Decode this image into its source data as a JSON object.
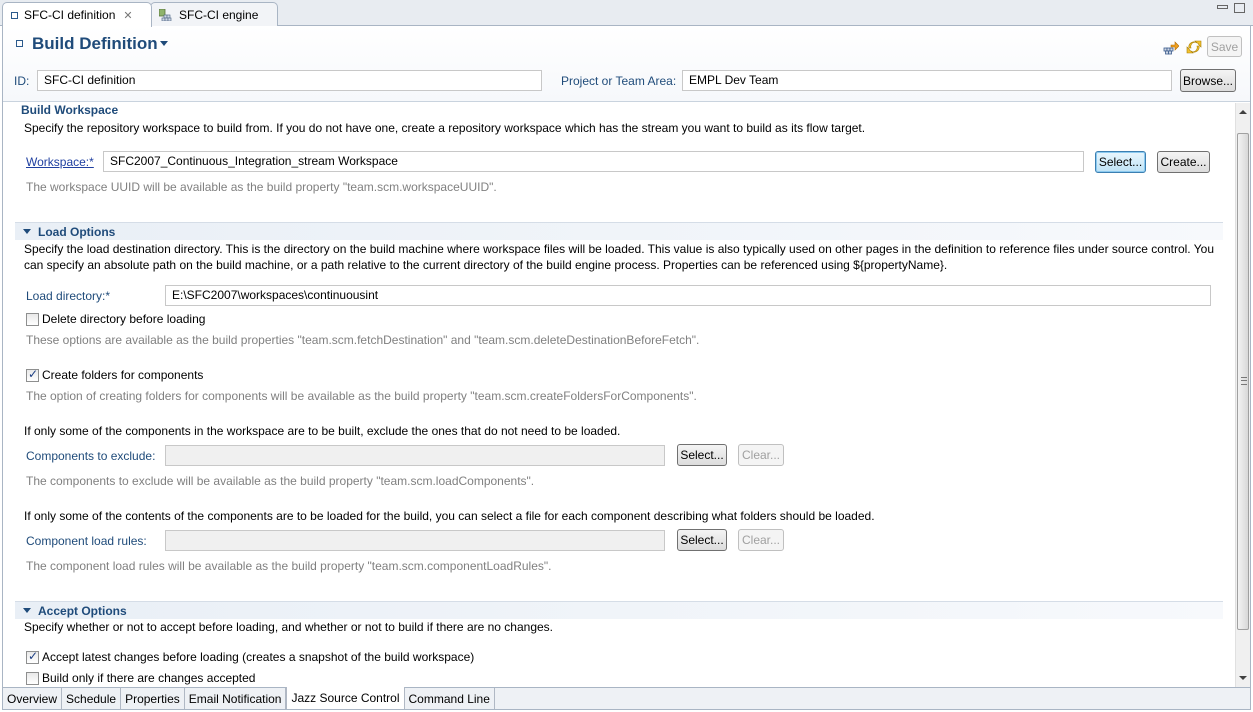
{
  "tabs": [
    {
      "label": "SFC-CI definition",
      "active": true,
      "closable": true,
      "icon": "editor-square-icon"
    },
    {
      "label": "SFC-CI engine",
      "active": false,
      "icon": "build-engine-icon"
    }
  ],
  "header": {
    "title": "Build Definition",
    "save_label": "Save",
    "id_label": "ID:",
    "id_value": "SFC-CI definition",
    "project_label": "Project or Team Area:",
    "project_value": "EMPL Dev Team",
    "browse_label": "Browse..."
  },
  "build_workspace": {
    "heading": "Build Workspace",
    "description": "Specify the repository workspace to build from. If you do not have one, create a repository workspace which has the stream you want to build as its flow target.",
    "workspace_label": "Workspace:*",
    "workspace_value": "SFC2007_Continuous_Integration_stream Workspace",
    "select_label": "Select...",
    "create_label": "Create...",
    "hint": "The workspace UUID will be available as the build property \"team.scm.workspaceUUID\"."
  },
  "load_options": {
    "heading": "Load Options",
    "description": "Specify the load destination directory. This is the directory on the build machine where workspace files will be loaded. This value is also typically used on other pages in the definition to reference files under source control. You can specify an absolute path on the build machine, or a path relative to the current directory of the build engine process. Properties can be referenced using ${propertyName}.",
    "load_dir_label": "Load directory:*",
    "load_dir_value": "E:\\SFC2007\\workspaces\\continuousint",
    "delete_dir_label": "Delete directory before loading",
    "delete_dir_checked": false,
    "delete_hint": "These options are available as the build properties \"team.scm.fetchDestination\" and \"team.scm.deleteDestinationBeforeFetch\".",
    "create_folders_label": "Create folders for components",
    "create_folders_checked": true,
    "create_folders_hint": "The option of creating folders for components will be available as the build property \"team.scm.createFoldersForComponents\".",
    "exclude_intro": "If only some of the components in the workspace are to be built, exclude the ones that do not need to be loaded.",
    "exclude_label": "Components to exclude:",
    "exclude_value": "",
    "exclude_select": "Select...",
    "exclude_clear": "Clear...",
    "exclude_hint": "The components to exclude will be available as the build property \"team.scm.loadComponents\".",
    "rules_intro": "If only some of the contents of the components are to be loaded for the build, you can select a file for each component describing what folders should be loaded.",
    "rules_label": "Component load rules:",
    "rules_value": "",
    "rules_select": "Select...",
    "rules_clear": "Clear...",
    "rules_hint": "The component load rules will be available as the build property \"team.scm.componentLoadRules\"."
  },
  "accept_options": {
    "heading": "Accept Options",
    "description": "Specify whether or not to accept before loading, and whether or not to build if there are no changes.",
    "accept_label": "Accept latest changes before loading (creates a snapshot of the build workspace)",
    "accept_checked": true,
    "build_only_label": "Build only if there are changes accepted",
    "build_only_checked": false
  },
  "page_tabs": [
    {
      "label": "Overview",
      "active": false
    },
    {
      "label": "Schedule",
      "active": false
    },
    {
      "label": "Properties",
      "active": false
    },
    {
      "label": "Email Notification",
      "active": false
    },
    {
      "label": "Jazz Source Control",
      "active": true
    },
    {
      "label": "Command Line",
      "active": false
    }
  ]
}
